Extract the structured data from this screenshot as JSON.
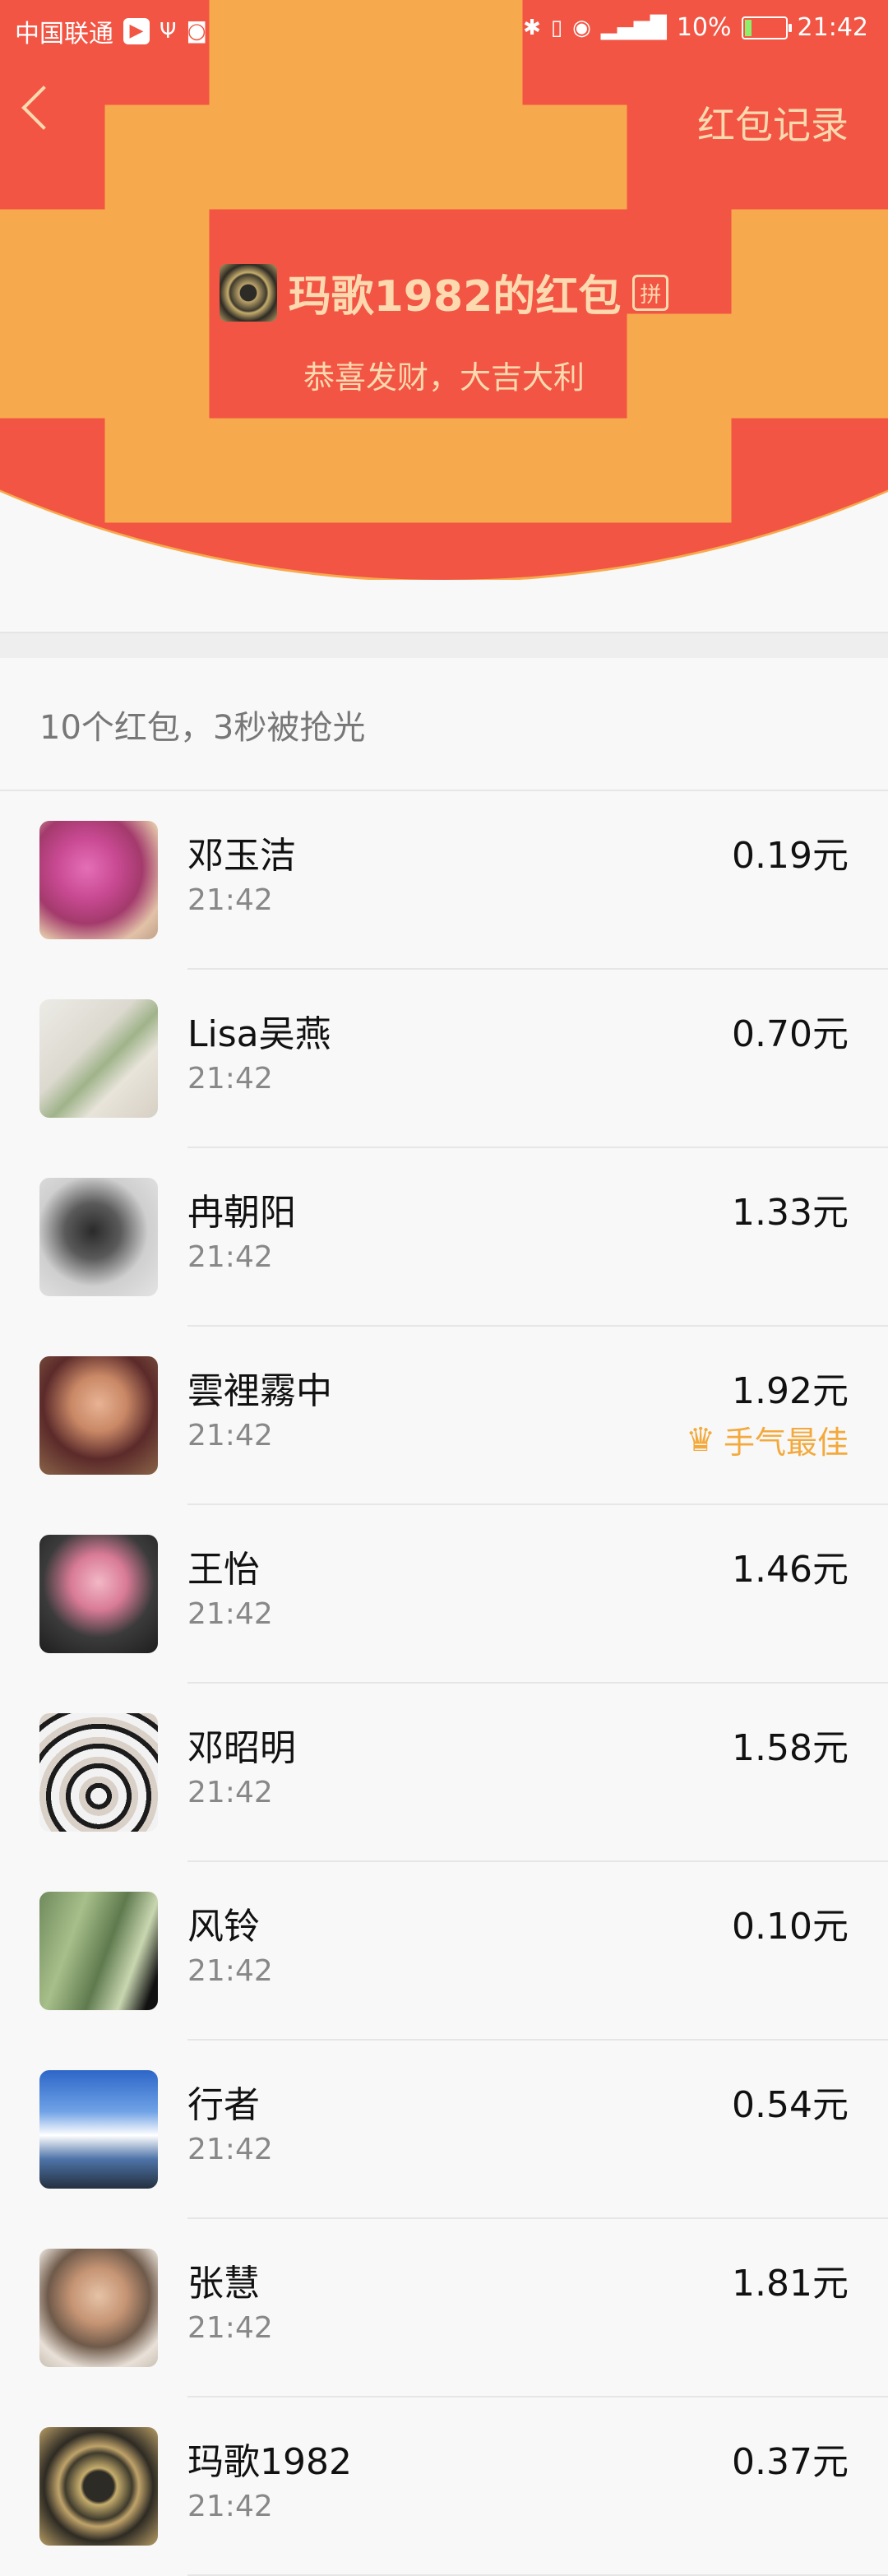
{
  "status_bar": {
    "carrier": "中国联通",
    "app_badge": "▶",
    "battery_percent": "10%",
    "time": "21:42"
  },
  "header": {
    "records_link": "红包记录",
    "title": "玛歌1982的红包",
    "pin_badge": "拼",
    "blessing": "恭喜发财，大吉大利"
  },
  "summary": "10个红包，3秒被抢光",
  "recipients": [
    {
      "name": "邓玉洁",
      "time": "21:42",
      "amount": "0.19元",
      "best_label": ""
    },
    {
      "name": "Lisa吴燕",
      "time": "21:42",
      "amount": "0.70元",
      "best_label": ""
    },
    {
      "name": "冉朝阳",
      "time": "21:42",
      "amount": "1.33元",
      "best_label": ""
    },
    {
      "name": "雲裡霧中",
      "time": "21:42",
      "amount": "1.92元",
      "best_label": "手气最佳"
    },
    {
      "name": "王怡",
      "time": "21:42",
      "amount": "1.46元",
      "best_label": ""
    },
    {
      "name": "邓昭明",
      "time": "21:42",
      "amount": "1.58元",
      "best_label": ""
    },
    {
      "name": "风铃",
      "time": "21:42",
      "amount": "0.10元",
      "best_label": ""
    },
    {
      "name": "行者",
      "time": "21:42",
      "amount": "0.54元",
      "best_label": ""
    },
    {
      "name": "张慧",
      "time": "21:42",
      "amount": "1.81元",
      "best_label": ""
    },
    {
      "name": "玛歌1982",
      "time": "21:42",
      "amount": "0.37元",
      "best_label": ""
    }
  ],
  "colors": {
    "header_red": "#f25543",
    "header_text": "#fdd9b0",
    "best_gold": "#f3a93b"
  }
}
